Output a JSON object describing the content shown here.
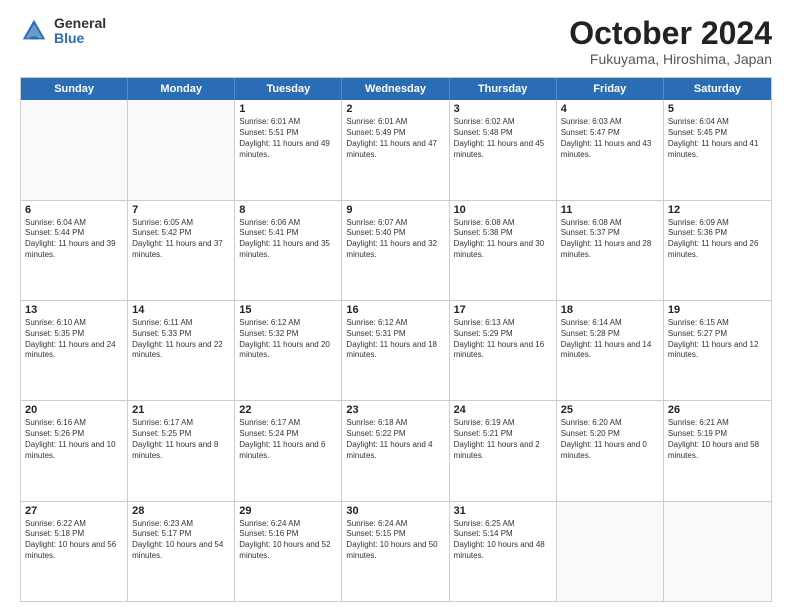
{
  "logo": {
    "general": "General",
    "blue": "Blue"
  },
  "title": {
    "month": "October 2024",
    "location": "Fukuyama, Hiroshima, Japan"
  },
  "header_days": [
    "Sunday",
    "Monday",
    "Tuesday",
    "Wednesday",
    "Thursday",
    "Friday",
    "Saturday"
  ],
  "weeks": [
    [
      {
        "day": "",
        "sunrise": "",
        "sunset": "",
        "daylight": "",
        "empty": true
      },
      {
        "day": "",
        "sunrise": "",
        "sunset": "",
        "daylight": "",
        "empty": true
      },
      {
        "day": "1",
        "sunrise": "Sunrise: 6:01 AM",
        "sunset": "Sunset: 5:51 PM",
        "daylight": "Daylight: 11 hours and 49 minutes."
      },
      {
        "day": "2",
        "sunrise": "Sunrise: 6:01 AM",
        "sunset": "Sunset: 5:49 PM",
        "daylight": "Daylight: 11 hours and 47 minutes."
      },
      {
        "day": "3",
        "sunrise": "Sunrise: 6:02 AM",
        "sunset": "Sunset: 5:48 PM",
        "daylight": "Daylight: 11 hours and 45 minutes."
      },
      {
        "day": "4",
        "sunrise": "Sunrise: 6:03 AM",
        "sunset": "Sunset: 5:47 PM",
        "daylight": "Daylight: 11 hours and 43 minutes."
      },
      {
        "day": "5",
        "sunrise": "Sunrise: 6:04 AM",
        "sunset": "Sunset: 5:45 PM",
        "daylight": "Daylight: 11 hours and 41 minutes."
      }
    ],
    [
      {
        "day": "6",
        "sunrise": "Sunrise: 6:04 AM",
        "sunset": "Sunset: 5:44 PM",
        "daylight": "Daylight: 11 hours and 39 minutes."
      },
      {
        "day": "7",
        "sunrise": "Sunrise: 6:05 AM",
        "sunset": "Sunset: 5:42 PM",
        "daylight": "Daylight: 11 hours and 37 minutes."
      },
      {
        "day": "8",
        "sunrise": "Sunrise: 6:06 AM",
        "sunset": "Sunset: 5:41 PM",
        "daylight": "Daylight: 11 hours and 35 minutes."
      },
      {
        "day": "9",
        "sunrise": "Sunrise: 6:07 AM",
        "sunset": "Sunset: 5:40 PM",
        "daylight": "Daylight: 11 hours and 32 minutes."
      },
      {
        "day": "10",
        "sunrise": "Sunrise: 6:08 AM",
        "sunset": "Sunset: 5:38 PM",
        "daylight": "Daylight: 11 hours and 30 minutes."
      },
      {
        "day": "11",
        "sunrise": "Sunrise: 6:08 AM",
        "sunset": "Sunset: 5:37 PM",
        "daylight": "Daylight: 11 hours and 28 minutes."
      },
      {
        "day": "12",
        "sunrise": "Sunrise: 6:09 AM",
        "sunset": "Sunset: 5:36 PM",
        "daylight": "Daylight: 11 hours and 26 minutes."
      }
    ],
    [
      {
        "day": "13",
        "sunrise": "Sunrise: 6:10 AM",
        "sunset": "Sunset: 5:35 PM",
        "daylight": "Daylight: 11 hours and 24 minutes."
      },
      {
        "day": "14",
        "sunrise": "Sunrise: 6:11 AM",
        "sunset": "Sunset: 5:33 PM",
        "daylight": "Daylight: 11 hours and 22 minutes."
      },
      {
        "day": "15",
        "sunrise": "Sunrise: 6:12 AM",
        "sunset": "Sunset: 5:32 PM",
        "daylight": "Daylight: 11 hours and 20 minutes."
      },
      {
        "day": "16",
        "sunrise": "Sunrise: 6:12 AM",
        "sunset": "Sunset: 5:31 PM",
        "daylight": "Daylight: 11 hours and 18 minutes."
      },
      {
        "day": "17",
        "sunrise": "Sunrise: 6:13 AM",
        "sunset": "Sunset: 5:29 PM",
        "daylight": "Daylight: 11 hours and 16 minutes."
      },
      {
        "day": "18",
        "sunrise": "Sunrise: 6:14 AM",
        "sunset": "Sunset: 5:28 PM",
        "daylight": "Daylight: 11 hours and 14 minutes."
      },
      {
        "day": "19",
        "sunrise": "Sunrise: 6:15 AM",
        "sunset": "Sunset: 5:27 PM",
        "daylight": "Daylight: 11 hours and 12 minutes."
      }
    ],
    [
      {
        "day": "20",
        "sunrise": "Sunrise: 6:16 AM",
        "sunset": "Sunset: 5:26 PM",
        "daylight": "Daylight: 11 hours and 10 minutes."
      },
      {
        "day": "21",
        "sunrise": "Sunrise: 6:17 AM",
        "sunset": "Sunset: 5:25 PM",
        "daylight": "Daylight: 11 hours and 8 minutes."
      },
      {
        "day": "22",
        "sunrise": "Sunrise: 6:17 AM",
        "sunset": "Sunset: 5:24 PM",
        "daylight": "Daylight: 11 hours and 6 minutes."
      },
      {
        "day": "23",
        "sunrise": "Sunrise: 6:18 AM",
        "sunset": "Sunset: 5:22 PM",
        "daylight": "Daylight: 11 hours and 4 minutes."
      },
      {
        "day": "24",
        "sunrise": "Sunrise: 6:19 AM",
        "sunset": "Sunset: 5:21 PM",
        "daylight": "Daylight: 11 hours and 2 minutes."
      },
      {
        "day": "25",
        "sunrise": "Sunrise: 6:20 AM",
        "sunset": "Sunset: 5:20 PM",
        "daylight": "Daylight: 11 hours and 0 minutes."
      },
      {
        "day": "26",
        "sunrise": "Sunrise: 6:21 AM",
        "sunset": "Sunset: 5:19 PM",
        "daylight": "Daylight: 10 hours and 58 minutes."
      }
    ],
    [
      {
        "day": "27",
        "sunrise": "Sunrise: 6:22 AM",
        "sunset": "Sunset: 5:18 PM",
        "daylight": "Daylight: 10 hours and 56 minutes."
      },
      {
        "day": "28",
        "sunrise": "Sunrise: 6:23 AM",
        "sunset": "Sunset: 5:17 PM",
        "daylight": "Daylight: 10 hours and 54 minutes."
      },
      {
        "day": "29",
        "sunrise": "Sunrise: 6:24 AM",
        "sunset": "Sunset: 5:16 PM",
        "daylight": "Daylight: 10 hours and 52 minutes."
      },
      {
        "day": "30",
        "sunrise": "Sunrise: 6:24 AM",
        "sunset": "Sunset: 5:15 PM",
        "daylight": "Daylight: 10 hours and 50 minutes."
      },
      {
        "day": "31",
        "sunrise": "Sunrise: 6:25 AM",
        "sunset": "Sunset: 5:14 PM",
        "daylight": "Daylight: 10 hours and 48 minutes."
      },
      {
        "day": "",
        "sunrise": "",
        "sunset": "",
        "daylight": "",
        "empty": true
      },
      {
        "day": "",
        "sunrise": "",
        "sunset": "",
        "daylight": "",
        "empty": true
      }
    ]
  ]
}
